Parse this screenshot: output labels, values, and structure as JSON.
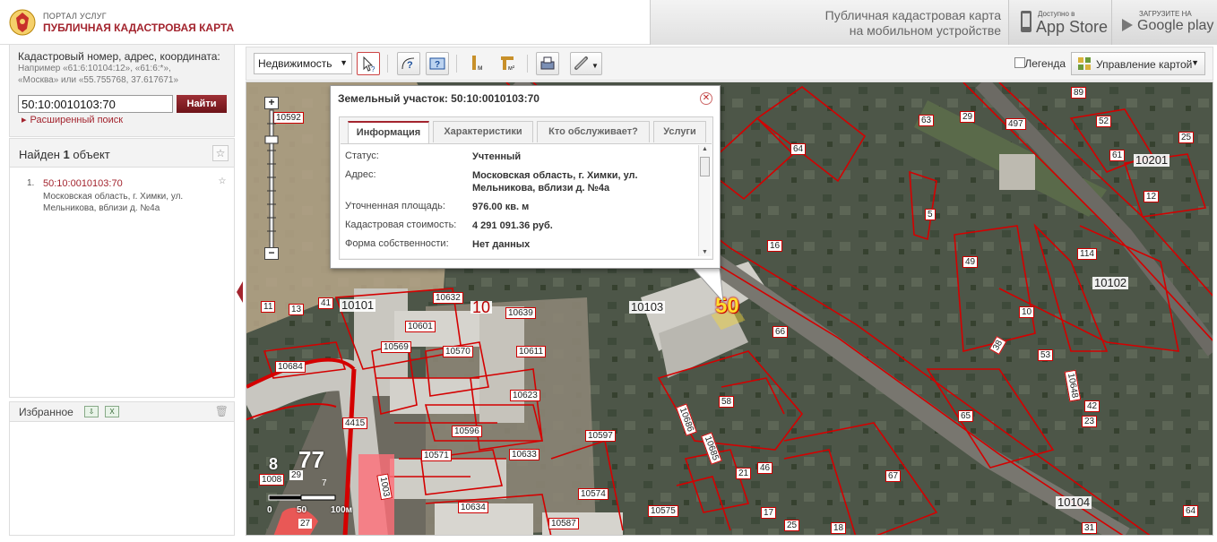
{
  "header": {
    "portal_line1": "ПОРТАЛ УСЛУГ",
    "portal_line2": "ПУБЛИЧНАЯ КАДАСТРОВАЯ КАРТА",
    "mobile_line1": "Публичная кадастровая карта",
    "mobile_line2": "на мобильном устройстве",
    "appstore_small": "Доступно в",
    "appstore_big": "App Store",
    "googleplay_small": "ЗАГРУЗИТЕ НА",
    "googleplay_big": "Google play"
  },
  "search": {
    "title": "Кадастровый номер, адрес, координата:",
    "example1": "Например «61:6:10104:12», «61:6:*»,",
    "example2": "«Москва» или «55.755768, 37.617671»",
    "value": "50:10:0010103:70",
    "button": "Найти",
    "advanced": "Расширенный поиск"
  },
  "results": {
    "title_prefix": "Найден",
    "count": "1",
    "title_suffix": "объект",
    "items": [
      {
        "num": "1.",
        "link": "50:10:0010103:70",
        "address": "Московская область, г. Химки, ул. Мельникова, вблизи д. №4а"
      }
    ]
  },
  "favorites": {
    "title": "Избранное"
  },
  "toolbar": {
    "layer": "Недвижимость",
    "legend": "Легенда",
    "map_control": "Управление картой"
  },
  "popup": {
    "title": "Земельный участок: 50:10:0010103:70",
    "tabs": [
      "Информация",
      "Характеристики",
      "Кто обслуживает?",
      "Услуги"
    ],
    "rows": [
      {
        "label": "Статус:",
        "value": "Учтенный"
      },
      {
        "label": "Адрес:",
        "value": "Московская область, г. Химки, ул. Мельникова, вблизи д. №4а"
      },
      {
        "label": "Уточненная площадь:",
        "value": "976.00 кв. м"
      },
      {
        "label": "Кадастровая стоимость:",
        "value": "4 291 091.36 руб."
      },
      {
        "label": "Форма собственности:",
        "value": "Нет данных"
      }
    ]
  },
  "map": {
    "parcel_label": "50",
    "scale": [
      "0",
      "50",
      "100м"
    ],
    "quarter_labels": [
      "10101",
      "10103",
      "10102",
      "10201",
      "10104"
    ],
    "region_labels": [
      "10",
      "77",
      "8"
    ],
    "parcel_numbers": [
      "10592",
      "10632",
      "10601",
      "10639",
      "10569",
      "10570",
      "10611",
      "10623",
      "10596",
      "10571",
      "10633",
      "10597",
      "10574",
      "10634",
      "10587",
      "10575",
      "10684",
      "4415",
      "1008",
      "29",
      "27",
      "7",
      "1003",
      "11",
      "13",
      "41",
      "64",
      "29",
      "89",
      "52",
      "25",
      "61",
      "12",
      "5",
      "49",
      "114",
      "16",
      "10",
      "53",
      "58",
      "42",
      "23",
      "65",
      "66",
      "67",
      "10686",
      "10685",
      "21",
      "46",
      "17",
      "25",
      "18",
      "31",
      "64",
      "497",
      "63",
      "38",
      "10648"
    ]
  },
  "colors": {
    "brand": "#a3242e",
    "parcel_border": "#d40000",
    "parcel_label": "#ffde2e"
  }
}
